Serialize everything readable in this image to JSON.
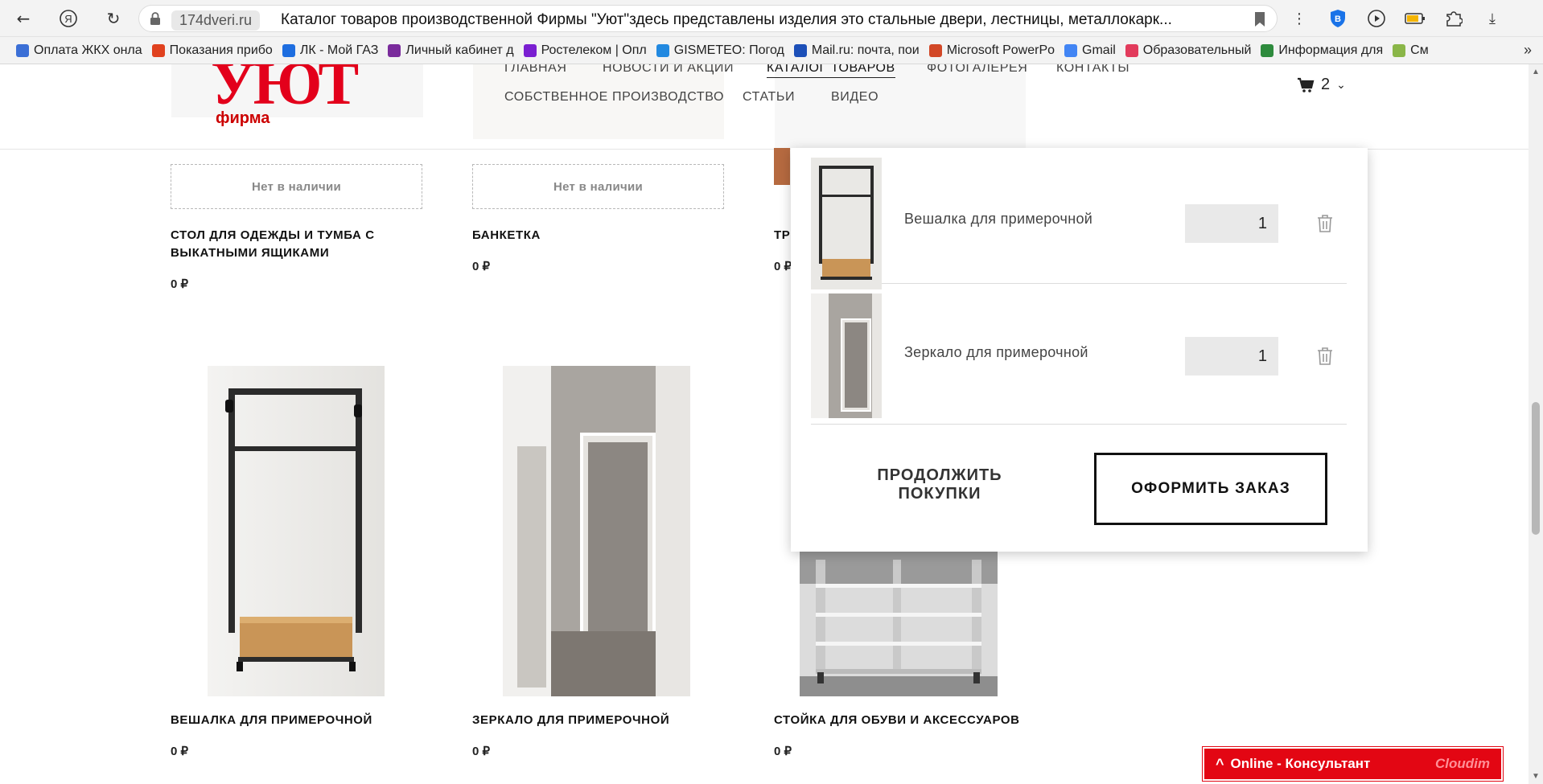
{
  "browser": {
    "domain": "174dveri.ru",
    "tab_title": "Каталог товаров производственной Фирмы \"Уют\"здесь представлены изделия это стальные двери, лестницы, металлокарк...",
    "bookmarks": [
      {
        "label": "Оплата ЖКХ онла",
        "color": "#3b6fd6"
      },
      {
        "label": "Показания прибо",
        "color": "#e0411e"
      },
      {
        "label": "ЛК - Мой ГАЗ",
        "color": "#1e6ee0"
      },
      {
        "label": "Личный кабинет д",
        "color": "#7a2b9c"
      },
      {
        "label": "Ростелеком | Опл",
        "color": "#7a1fd1"
      },
      {
        "label": "GISMETEO: Погод",
        "color": "#2289e0"
      },
      {
        "label": "Mail.ru: почта, пои",
        "color": "#1c4fb8"
      },
      {
        "label": "Microsoft PowerPo",
        "color": "#d24726"
      },
      {
        "label": "Gmail",
        "color": "#4285f4"
      },
      {
        "label": "Образовательный",
        "color": "#e23b5c"
      },
      {
        "label": "Информация для",
        "color": "#2e8b3d"
      },
      {
        "label": "См",
        "color": "#8ab648"
      }
    ],
    "bookmarks_more": "»"
  },
  "site": {
    "logo": {
      "main": "УЮТ",
      "sub": "фирма"
    },
    "menu": [
      {
        "label": "ГЛАВНАЯ"
      },
      {
        "label": "НОВОСТИ И АКЦИИ"
      },
      {
        "label": "КАТАЛОГ ТОВАРОВ"
      },
      {
        "label": "ФОТОГАЛЕРЕЯ"
      },
      {
        "label": "КОНТАКТЫ"
      },
      {
        "label": "СОБСТВЕННОЕ ПРОИЗВОДСТВО"
      },
      {
        "label": "СТАТЬИ"
      },
      {
        "label": "ВИДЕО"
      }
    ],
    "cart_count": "2"
  },
  "products_top": [
    {
      "stock": "Нет в наличии",
      "title": "СТОЛ ДЛЯ ОДЕЖДЫ И ТУМБА С ВЫКАТНЫМИ ЯЩИКАМИ",
      "price": "0 ₽"
    },
    {
      "stock": "Нет в наличии",
      "title": "БАНКЕТКА",
      "price": "0 ₽"
    },
    {
      "title": "ТР",
      "price": "0 ₽"
    }
  ],
  "products_bottom": [
    {
      "title": "ВЕШАЛКА ДЛЯ ПРИМЕРОЧНОЙ",
      "price": "0 ₽"
    },
    {
      "title": "ЗЕРКАЛО ДЛЯ ПРИМЕРОЧНОЙ",
      "price": "0 ₽"
    },
    {
      "title": "СТОЙКА ДЛЯ ОБУВИ И АКСЕССУАРОВ",
      "price": "0 ₽"
    }
  ],
  "cart_popup": {
    "items": [
      {
        "name": "Вешалка для примерочной",
        "qty": "1"
      },
      {
        "name": "Зеркало для примерочной",
        "qty": "1"
      }
    ],
    "continue_label": "ПРОДОЛЖИТЬ ПОКУПКИ",
    "order_label": "ОФОРМИТЬ ЗАКАЗ"
  },
  "consultant": {
    "arrow": "^",
    "label": "Online - Консультант",
    "brand": "Cloudim"
  }
}
